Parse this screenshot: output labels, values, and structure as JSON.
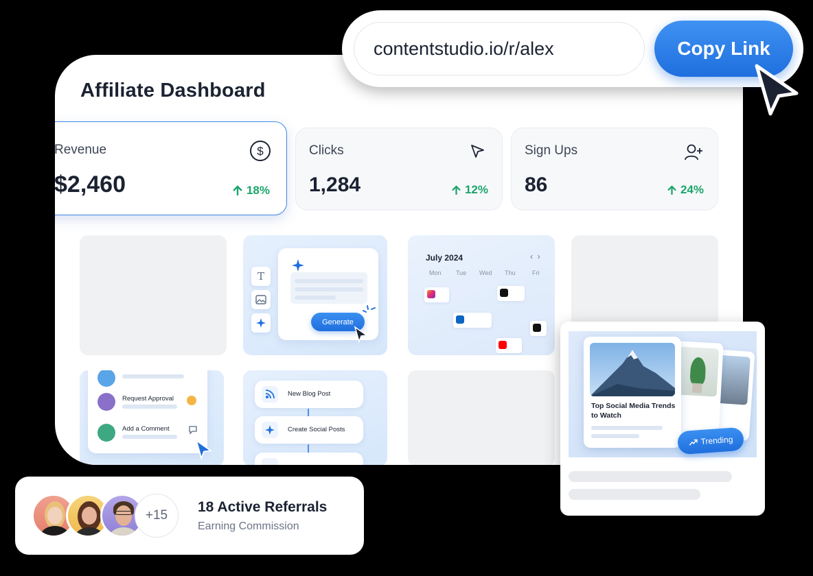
{
  "link_bar": {
    "url": "contentstudio.io/r/alex",
    "copy_label": "Copy Link"
  },
  "dashboard": {
    "title": "Affiliate Dashboard",
    "stats": [
      {
        "label": "Revenue",
        "value": "$2,460",
        "delta": "18%",
        "icon": "dollar-circle-icon"
      },
      {
        "label": "Clicks",
        "value": "1,284",
        "delta": "12%",
        "icon": "cursor-icon"
      },
      {
        "label": "Sign Ups",
        "value": "86",
        "delta": "24%",
        "icon": "user-plus-icon"
      }
    ],
    "ai_tile": {
      "generate_label": "Generate"
    },
    "calendar_tile": {
      "month": "July 2024",
      "days": [
        "Mon",
        "Tue",
        "Wed",
        "Thu",
        "Fri"
      ]
    },
    "approval_tile": {
      "items": [
        "Request Approval",
        "Add a Comment"
      ]
    },
    "workflow_tile": {
      "items": [
        "New Blog Post",
        "Create Social Posts"
      ]
    }
  },
  "referrals": {
    "extra_count": "+15",
    "title": "18 Active Referrals",
    "subtitle": "Earning Commission"
  },
  "trending_card": {
    "post_title": "Top Social Media Trends to Watch",
    "badge": "Trending"
  },
  "colors": {
    "accent": "#1f6fde",
    "positive": "#1aa56a",
    "active_border": "#3e86e8"
  }
}
